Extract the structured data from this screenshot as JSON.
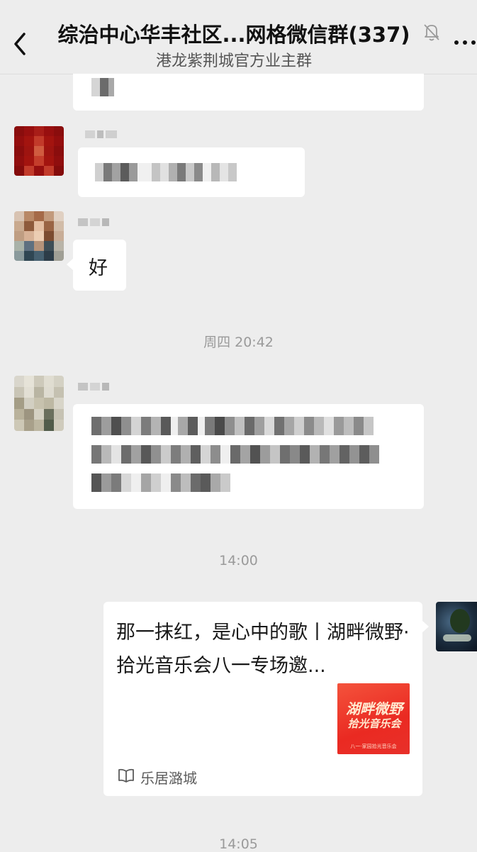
{
  "header": {
    "title": "综治中心华丰社区...网格微信群(337)",
    "subtitle": "港龙紫荆城官方业主群",
    "more_label": "..."
  },
  "messages": [
    {
      "type": "text",
      "content": "好"
    }
  ],
  "time_dividers": {
    "first": "周四 20:42",
    "second": "14:00",
    "third": "14:05"
  },
  "link_card": {
    "title": "那一抹红，是心中的歌丨湖畔微野·拾光音乐会八一专场邀...",
    "source": "乐居潞城",
    "source_icon": "book-icon",
    "thumbnail": {
      "line1": "湖畔微野",
      "line2": "拾光音乐会",
      "footer": "八一·家园拾光音乐会"
    }
  },
  "colors": {
    "background": "#ededed",
    "bubble": "#ffffff",
    "thumbnail_red": "#ea2a22"
  }
}
